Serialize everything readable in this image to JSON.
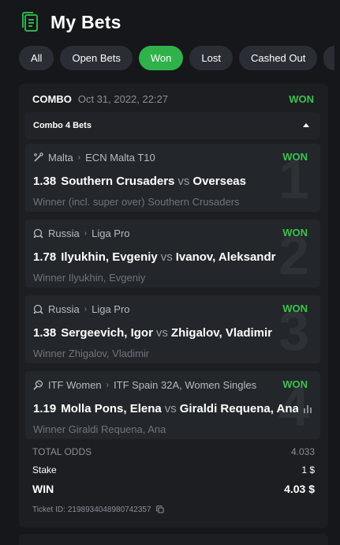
{
  "header": {
    "title": "My Bets",
    "icon": "bets-list-icon"
  },
  "tabs": [
    {
      "label": "All",
      "active": false
    },
    {
      "label": "Open Bets",
      "active": false
    },
    {
      "label": "Won",
      "active": true
    },
    {
      "label": "Lost",
      "active": false
    },
    {
      "label": "Cashed Out",
      "active": false
    }
  ],
  "colors": {
    "accent": "#2fb24a",
    "won": "#3cc24d",
    "background": "#15171b",
    "card": "#1c1e22"
  },
  "bet": {
    "type": "COMBO",
    "date": "Oct 31, 2022, 22:27",
    "status": "WON",
    "combo_title": "Combo 4 Bets",
    "legs": [
      {
        "number": "1",
        "sport_icon": "cricket-icon",
        "country": "Malta",
        "league": "ECN Malta T10",
        "status": "WON",
        "odds": "1.38",
        "home": "Southern Crusaders",
        "vs": "vs",
        "away": "Overseas",
        "selection": "Winner (incl. super over) Southern Crusaders"
      },
      {
        "number": "2",
        "sport_icon": "table-tennis-icon",
        "country": "Russia",
        "league": "Liga Pro",
        "status": "WON",
        "odds": "1.78",
        "home": "Ilyukhin, Evgeniy",
        "vs": "vs",
        "away": "Ivanov, Aleksandr",
        "selection": "Winner Ilyukhin, Evgeniy"
      },
      {
        "number": "3",
        "sport_icon": "table-tennis-icon",
        "country": "Russia",
        "league": "Liga Pro",
        "status": "WON",
        "odds": "1.38",
        "home": "Sergeevich, Igor",
        "vs": "vs",
        "away": "Zhigalov, Vladimir",
        "selection": "Winner Zhigalov, Vladimir"
      },
      {
        "number": "4",
        "sport_icon": "tennis-icon",
        "country": "ITF Women",
        "league": "ITF Spain 32A, Women Singles",
        "status": "WON",
        "odds": "1.19",
        "home": "Molla Pons, Elena",
        "vs": "vs",
        "away": "Giraldi Requena, Ana",
        "selection": "Winner Giraldi Requena, Ana"
      }
    ],
    "total_odds_label": "TOTAL ODDS",
    "total_odds": "4.033",
    "stake_label": "Stake",
    "stake": "1 $",
    "win_label": "WIN",
    "win": "4.03 $",
    "ticket_label": "Ticket ID:",
    "ticket_id": "2198934048980742357"
  }
}
